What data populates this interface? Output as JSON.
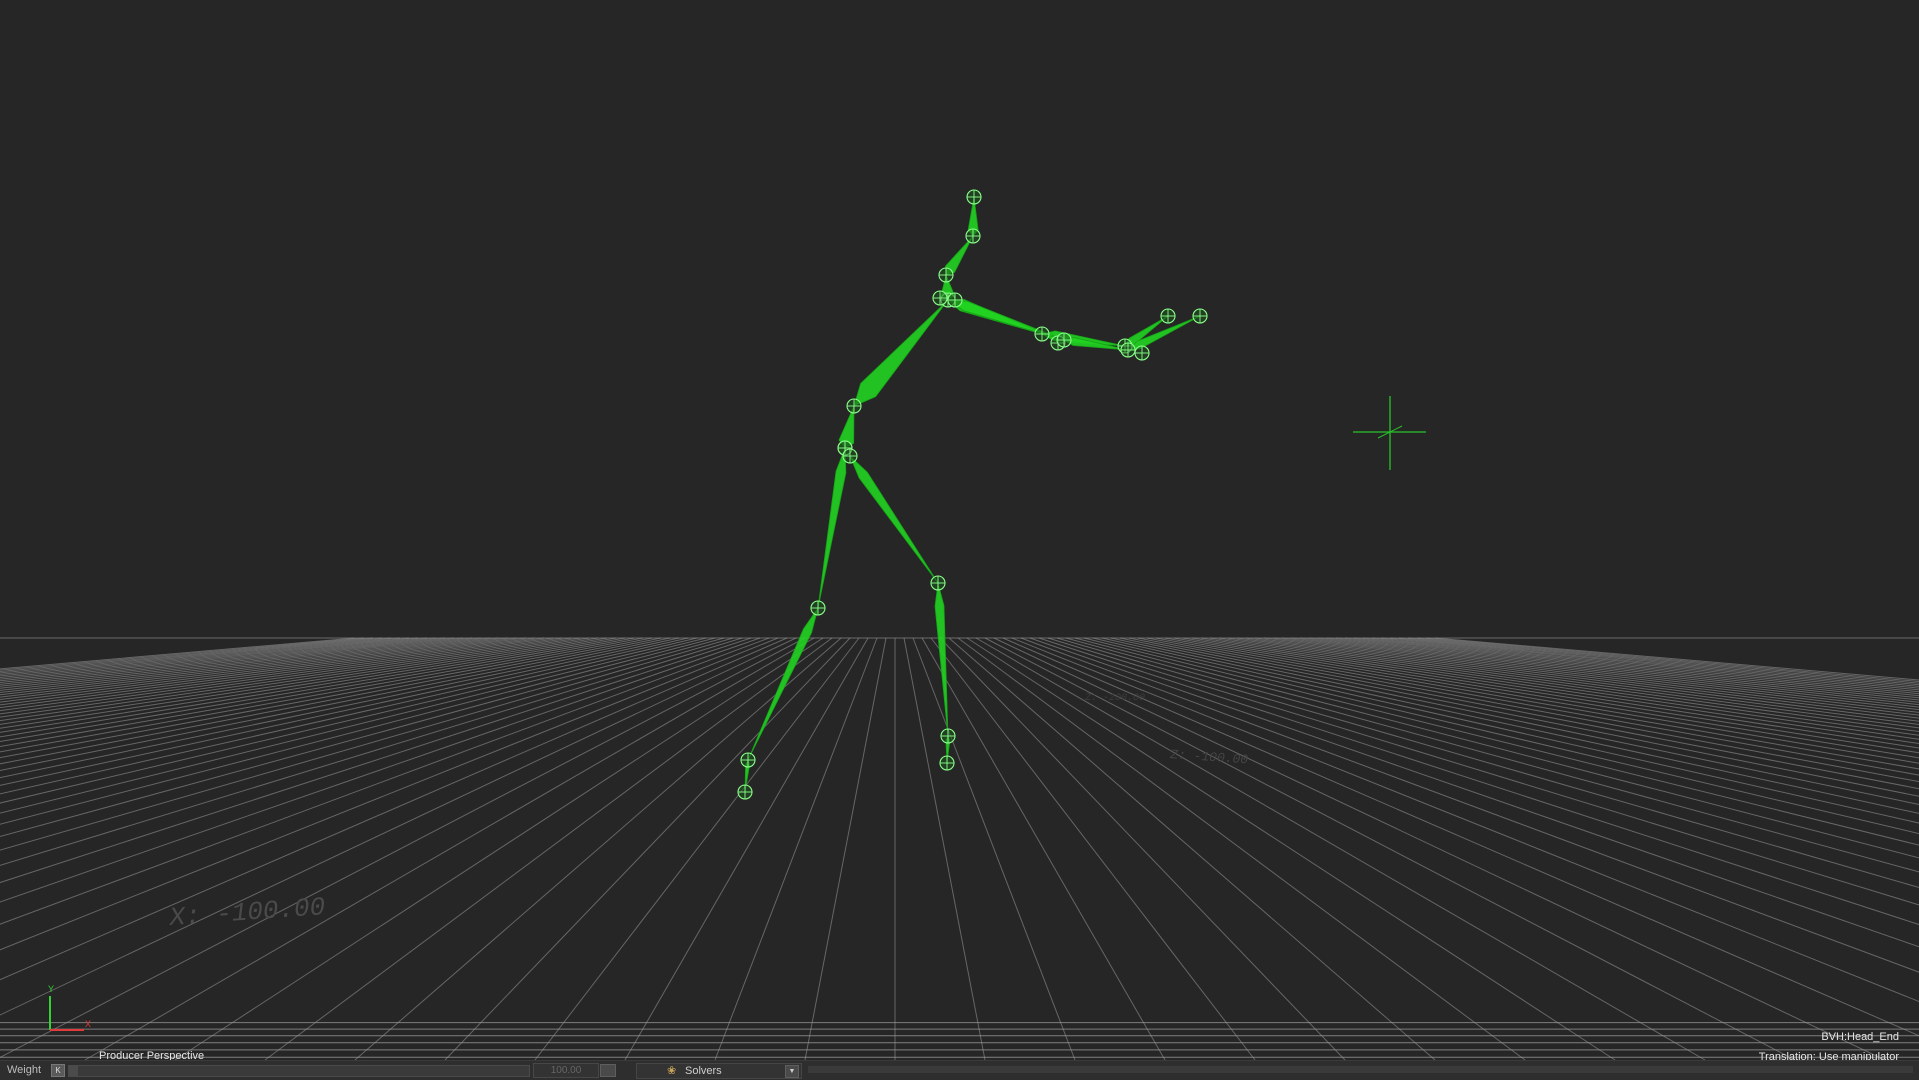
{
  "viewer": {
    "camera_label": "Producer Perspective",
    "selection_label": "BVH:Head_End",
    "manipulator_label": "Translation: Use manipulator",
    "grid_labels": [
      "X: -100.00",
      "Z: -100.00",
      "Z: -200.00"
    ],
    "axis_y": "Y",
    "axis_x": "X"
  },
  "bottom_bar": {
    "weight_label": "Weight",
    "weight_key": "K",
    "weight_value": "100.00",
    "weight_fraction": 0.02,
    "solvers_label": "Solvers",
    "solvers_icon": "solver-icon"
  },
  "colors": {
    "background": "#262626",
    "skeleton": "#21d421",
    "skeleton_outline": "#8bff8b",
    "grid": "#9a9a9a",
    "axis_x": "#e23b3b",
    "axis_y": "#33d133"
  }
}
